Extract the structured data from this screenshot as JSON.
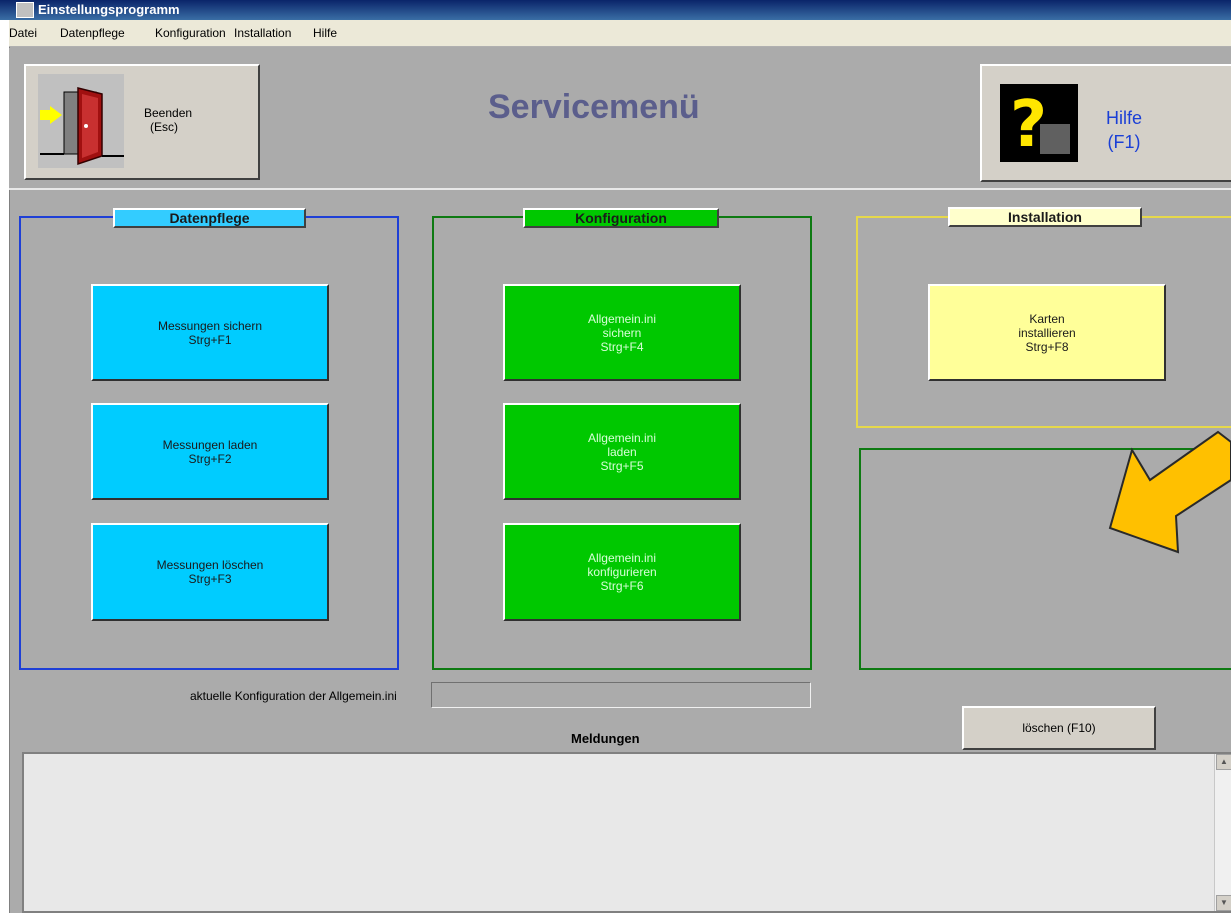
{
  "window": {
    "title": "Einstellungsprogramm"
  },
  "menu": [
    "Datei",
    "Datenpflege",
    "Konfiguration",
    "Installation",
    "Hilfe"
  ],
  "header": {
    "exit_line1": "Beenden",
    "exit_line2": "(Esc)",
    "title": "Servicemenü",
    "help_line1": "Hilfe",
    "help_line2": "(F1)"
  },
  "datenpflege": {
    "legend": "Datenpflege",
    "buttons": [
      {
        "line1": "Messungen sichern",
        "line2": "Strg+F1"
      },
      {
        "line1": "Messungen laden",
        "line2": "Strg+F2"
      },
      {
        "line1": "Messungen löschen",
        "line2": "Strg+F3"
      }
    ]
  },
  "konfiguration": {
    "legend": "Konfiguration",
    "buttons": [
      {
        "line1": "Allgemein.ini",
        "line2": "sichern",
        "line3": "Strg+F4"
      },
      {
        "line1": "Allgemein.ini",
        "line2": "laden",
        "line3": "Strg+F5"
      },
      {
        "line1": "Allgemein.ini",
        "line2": "konfigurieren",
        "line3": "Strg+F6"
      }
    ]
  },
  "installation": {
    "legend": "Installation",
    "buttons": [
      {
        "line1": "Karten",
        "line2": "installieren",
        "line3": "Strg+F8"
      }
    ]
  },
  "config": {
    "label": "aktuelle Konfiguration der Allgemein.ini",
    "value": ""
  },
  "messages": {
    "label": "Meldungen",
    "clear": "löschen (F10)"
  },
  "colors": {
    "background": "#ababab",
    "datenpflege": "#00ccff",
    "konfiguration": "#00c800",
    "installation": "#ffff99",
    "arrow": "#ffc000",
    "title": "#5b5e8c",
    "help_text": "#1a3fd6"
  }
}
